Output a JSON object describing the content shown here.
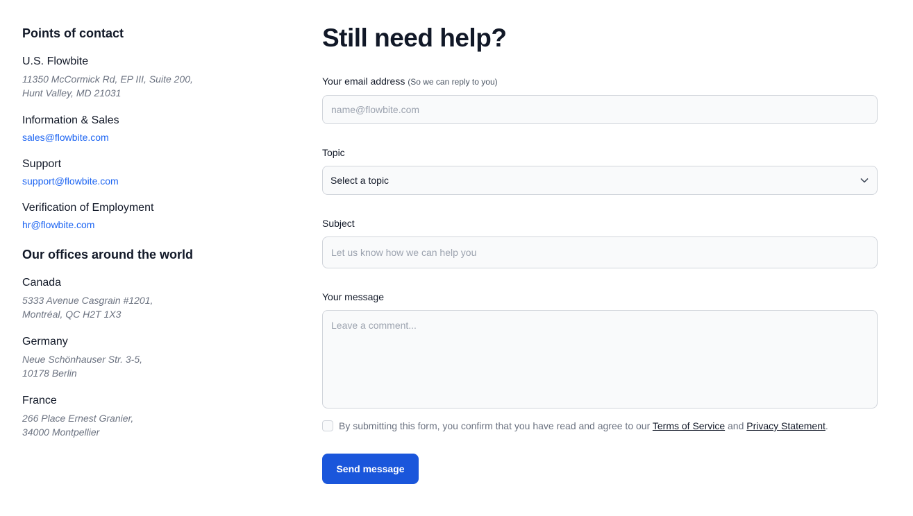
{
  "contacts": {
    "title": "Points of contact",
    "us": {
      "name": "U.S. Flowbite",
      "address": "11350 McCormick Rd, EP III, Suite 200,\nHunt Valley, MD 21031"
    },
    "sales": {
      "name": "Information & Sales",
      "email": "sales@flowbite.com"
    },
    "support": {
      "name": "Support",
      "email": "support@flowbite.com"
    },
    "hr": {
      "name": "Verification of Employment",
      "email": "hr@flowbite.com"
    }
  },
  "offices": {
    "title": "Our offices around the world",
    "items": [
      {
        "name": "Canada",
        "address": "5333 Avenue Casgrain #1201,\nMontréal, QC H2T 1X3"
      },
      {
        "name": "Germany",
        "address": "Neue Schönhauser Str. 3-5,\n10178 Berlin"
      },
      {
        "name": "France",
        "address": "266 Place Ernest Granier,\n34000 Montpellier"
      }
    ]
  },
  "form": {
    "title": "Still need help?",
    "email_label": "Your email address",
    "email_hint": "(So we can reply to you)",
    "email_placeholder": "name@flowbite.com",
    "topic_label": "Topic",
    "topic_value": "Select a topic",
    "subject_label": "Subject",
    "subject_placeholder": "Let us know how we can help you",
    "message_label": "Your message",
    "message_placeholder": "Leave a comment...",
    "terms_pre": "By submitting this form, you confirm that you have read and agree to our",
    "terms_link": "Terms of Service",
    "terms_and": "and",
    "privacy_link": "Privacy Statement",
    "terms_end": ".",
    "submit": "Send message"
  }
}
